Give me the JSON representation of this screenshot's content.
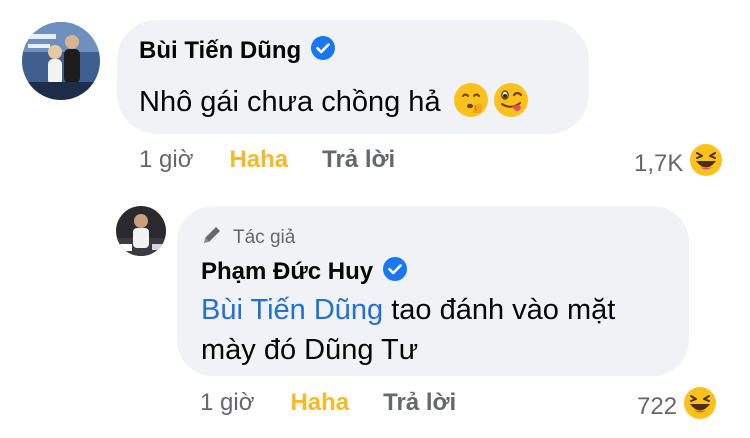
{
  "comment": {
    "author": "Bùi Tiến Dũng",
    "text": "Nhô gái chưa chồng hả",
    "emojis": [
      "shushing-face-emoji",
      "winking-tongue-emoji"
    ],
    "time": "1 giờ",
    "reaction_label": "Haha",
    "reply_label": "Trả lời",
    "reaction_count": "1,7K",
    "reaction_icon": "haha-reaction-icon",
    "verified": true
  },
  "reply": {
    "author_badge": "Tác giả",
    "author": "Phạm Đức Huy",
    "mention": "Bùi Tiến Dũng",
    "text_line1": " tao đánh vào mặt",
    "text_line2": "mày đó Dũng Tư",
    "time": "1 giờ",
    "reaction_label": "Haha",
    "reply_label": "Trả lời",
    "reaction_count": "722",
    "reaction_icon": "haha-reaction-icon",
    "verified": true
  },
  "colors": {
    "bubble": "#f0f2f5",
    "verified": "#1877f2",
    "haha": "#f7b928",
    "mention": "#216fdb",
    "meta_text": "#65676b"
  }
}
